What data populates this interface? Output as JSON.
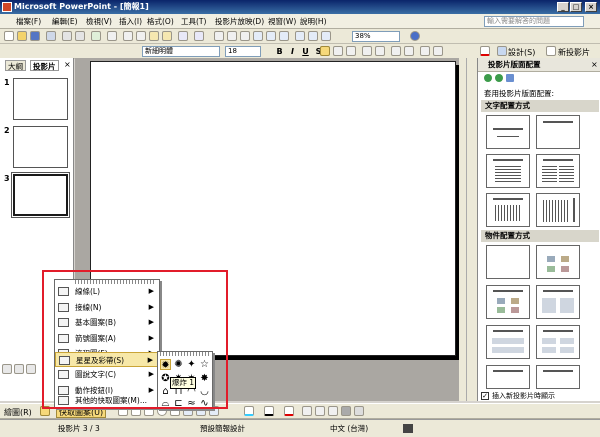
{
  "window": {
    "title": "Microsoft PowerPoint - [簡報1]",
    "min": "_",
    "max": "□",
    "close": "×"
  },
  "menubar": {
    "items": [
      "檔案(F)",
      "編輯(E)",
      "檢視(V)",
      "插入(I)",
      "格式(O)",
      "工具(T)",
      "投影片放映(D)",
      "視窗(W)",
      "說明(H)"
    ],
    "help_placeholder": "輸入需要解答的問題"
  },
  "standard_toolbar": {
    "zoom": "38%"
  },
  "format_toolbar": {
    "font": "新細明體",
    "size": "18",
    "bold": "B",
    "italic": "I",
    "underline": "U",
    "shadow": "S",
    "design_label": "設計(S)",
    "new_slide_label": "新投影片(N)"
  },
  "left_pane": {
    "tabs": [
      "大綱",
      "投影片"
    ],
    "close": "×",
    "thumbnails": [
      "1",
      "2",
      "3"
    ]
  },
  "task_pane": {
    "title": "投影片版面配置",
    "close": "×",
    "apply_label": "套用投影片版面配置:",
    "section_text": "文字配置方式",
    "section_content": "物件配置方式",
    "show_on_insert": "插入新投影片時顯示",
    "checked": "✓"
  },
  "draw_toolbar": {
    "draw_label": "繪圖(R)",
    "autoshape_label": "快取圖案(U)"
  },
  "autoshape_menu": {
    "items": [
      {
        "label": "線條(L)",
        "has_sub": true
      },
      {
        "label": "接線(N)",
        "has_sub": true
      },
      {
        "label": "基本圖案(B)",
        "has_sub": true
      },
      {
        "label": "箭號圖案(A)",
        "has_sub": true
      },
      {
        "label": "流程圖(F)",
        "has_sub": true
      },
      {
        "label": "星星及彩帶(S)",
        "has_sub": true
      },
      {
        "label": "圖說文字(C)",
        "has_sub": true
      },
      {
        "label": "動作按鈕(I)",
        "has_sub": true
      },
      {
        "label": "其他的快取圖案(M)...",
        "has_sub": false
      }
    ],
    "submenu_glyphs": [
      "✹",
      "✺",
      "✦",
      "☆",
      "✪",
      "✷",
      "✶",
      "✸",
      "⌂",
      "⊓",
      "◠",
      "◡",
      "⌓",
      "⊏",
      "≈",
      "∿"
    ],
    "tooltip": "爆炸 1"
  },
  "status_bar": {
    "slide": "投影片 3 / 3",
    "design": "預設簡報設計",
    "language": "中文 (台灣)"
  }
}
